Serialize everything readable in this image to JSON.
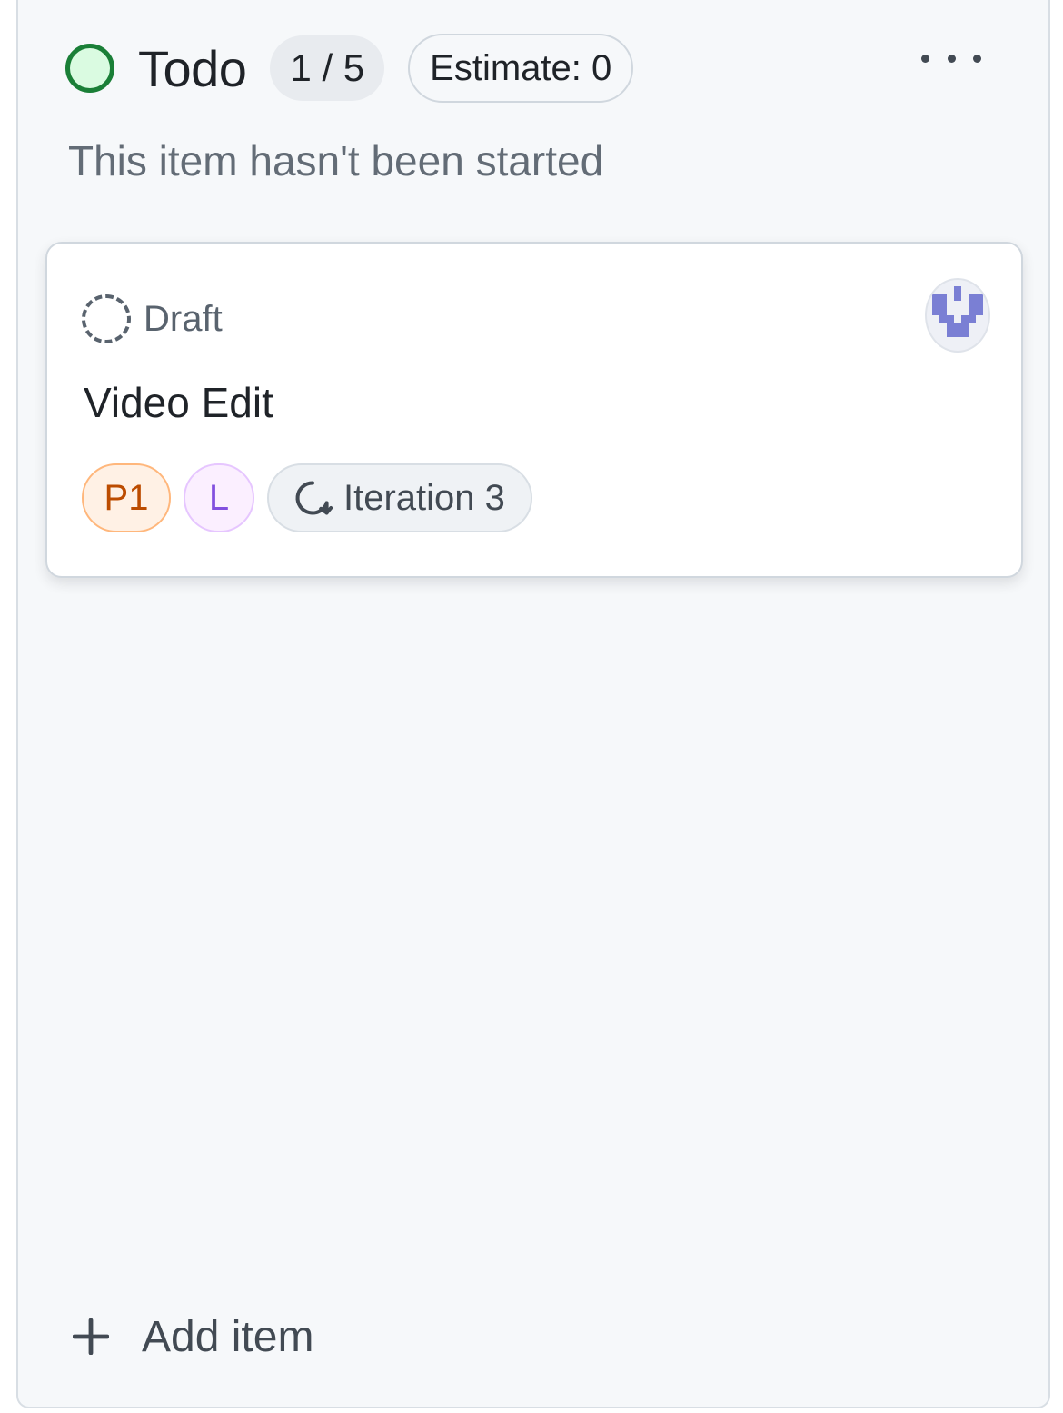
{
  "column": {
    "title": "Todo",
    "count": "1 / 5",
    "estimate": "Estimate: 0",
    "description": "This item hasn't been started",
    "status_color": "#1a7f37"
  },
  "card": {
    "state": "Draft",
    "title": "Video Edit",
    "labels": {
      "priority": "P1",
      "size": "L",
      "iteration": "Iteration 3"
    }
  },
  "footer": {
    "add_item": "Add item"
  },
  "icons": {
    "status": "circle-open-icon",
    "draft": "dashed-circle-icon",
    "iteration": "iteration-cycle-icon",
    "more": "kebab-horizontal-icon",
    "add": "plus-icon"
  }
}
